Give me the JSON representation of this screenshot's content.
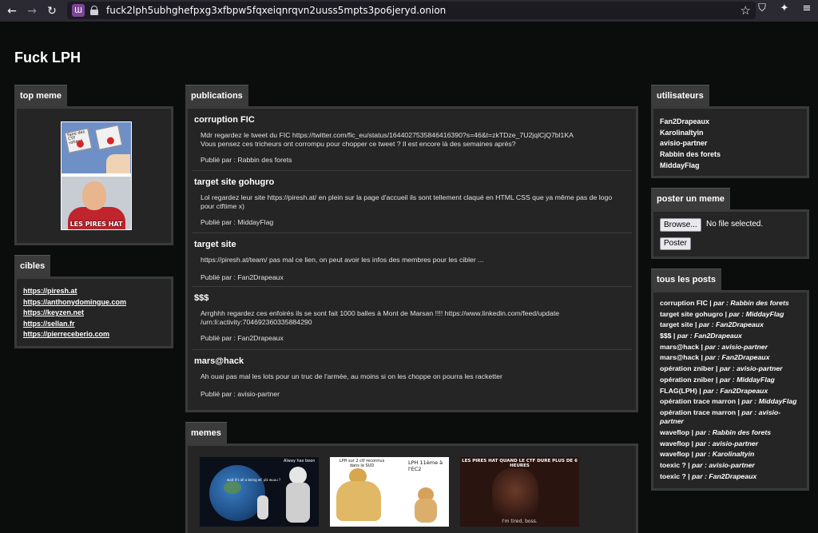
{
  "browser": {
    "url": "fuck2lph5ubhghefpxg3xfbpw5fqxeiqnrqvn2uuss5mpts3po6jeryd.onion"
  },
  "site": {
    "title": "Fuck LPH"
  },
  "top_meme": {
    "tab": "top meme",
    "button_left": "Faire des CTF rotieux",
    "caption": "LES PIRES HAT"
  },
  "cibles": {
    "tab": "cibles",
    "links": [
      "https://piresh.at",
      "https://anthonydomingue.com",
      "https://keyzen.net",
      "https://sellan.fr",
      "https://pierreceberio.com"
    ]
  },
  "publications": {
    "tab": "publications",
    "posts": [
      {
        "title": "corruption FIC",
        "body_lines": [
          "Mdr regardez le tweet du FIC https://twitter.com/fic_eu/status/1644027535846416390?s=46&t=zkTDze_7U2jqlCjQ7bl1KA",
          "Vous pensez ces tricheurs ont corrompu pour chopper ce tweet ? Il est encore là des semaines après?"
        ],
        "author": "Publié par : Rabbin des forets"
      },
      {
        "title": "target site gohugro",
        "body_lines": [
          "Lol regardez leur site https://piresh.at/ en plein sur la page d'accueil ils sont tellement claqué en HTML CSS que ya même pas de logo",
          "pour ctftime x)"
        ],
        "author": "Publié par : MiddayFlag"
      },
      {
        "title": "target site",
        "body_lines": [
          "https://piresh.at/team/ pas mal ce lien, on peut avoir les infos des membres pour les cibler ..."
        ],
        "author": "Publié par : Fan2Drapeaux"
      },
      {
        "title": "$$$",
        "body_lines": [
          "Arrghhh regardez ces enfoirés ils se sont fait 1000 balles à Mont de Marsan !!!! https://www.linkedin.com/feed/update",
          "/urn:li:activity:7046923603358842​90"
        ],
        "author": "Publié par : Fan2Drapeaux"
      },
      {
        "title": "mars@hack",
        "body_lines": [
          "Ah ouai pas mal les lots pour un truc de l'armée, au moins si on les choppe on pourra les racketter"
        ],
        "author": "Publié par : avisio-partner"
      }
    ]
  },
  "memes": {
    "tab": "memes",
    "items": [
      {
        "top": "Alway has been",
        "mid": "wait it's all a being wf. plz wuuu ?"
      },
      {
        "left": "LPH sur 2 ctf reconnus dans le SUD",
        "right": "LPH 11ème à l'EC2"
      },
      {
        "top": "LES PIRES HAT QUAND LE CTF DURE PLUS DE 6 HEURES",
        "bottom": "I'm tired, boss."
      }
    ]
  },
  "utilisateurs": {
    "tab": "utilisateurs",
    "names": [
      "Fan2Drapeaux",
      "Karolinaltyin",
      "avisio-partner",
      "Rabbin des forets",
      "MiddayFlag"
    ]
  },
  "poster_meme": {
    "tab": "poster un meme",
    "browse": "Browse...",
    "no_file": "No file selected.",
    "submit": "Poster"
  },
  "tous_les_posts": {
    "tab": "tous les posts",
    "items": [
      {
        "title": "corruption FIC",
        "sep": " | ",
        "by": "par : Rabbin des forets"
      },
      {
        "title": "target site gohugro",
        "sep": " | ",
        "by": "par : MiddayFlag"
      },
      {
        "title": "target site",
        "sep": " | ",
        "by": "par : Fan2Drapeaux"
      },
      {
        "title": "$$$",
        "sep": " | ",
        "by": "par : Fan2Drapeaux"
      },
      {
        "title": "mars@hack",
        "sep": " | ",
        "by": "par : avisio-partner"
      },
      {
        "title": "mars@hack",
        "sep": " | ",
        "by": "par : Fan2Drapeaux"
      },
      {
        "title": "opération zniber",
        "sep": " | ",
        "by": "par : avisio-partner"
      },
      {
        "title": "opération zniber",
        "sep": " | ",
        "by": "par : MiddayFlag"
      },
      {
        "title": "FLAG(LPH)",
        "sep": " | ",
        "by": "par : Fan2Drapeaux"
      },
      {
        "title": "opération trace marron",
        "sep": " | ",
        "by": "par : MiddayFlag"
      },
      {
        "title": "opération trace marron",
        "sep": " | ",
        "by": "par : avisio-partner"
      },
      {
        "title": "waveflop",
        "sep": " | ",
        "by": "par : Rabbin des forets"
      },
      {
        "title": "waveflop",
        "sep": " | ",
        "by": "par : avisio-partner"
      },
      {
        "title": "waveflop",
        "sep": " | ",
        "by": "par : Karolinaltyin"
      },
      {
        "title": "toexic ?",
        "sep": " | ",
        "by": "par : avisio-partner"
      },
      {
        "title": "toexic ?",
        "sep": " | ",
        "by": "par : Fan2Drapeaux"
      }
    ]
  }
}
